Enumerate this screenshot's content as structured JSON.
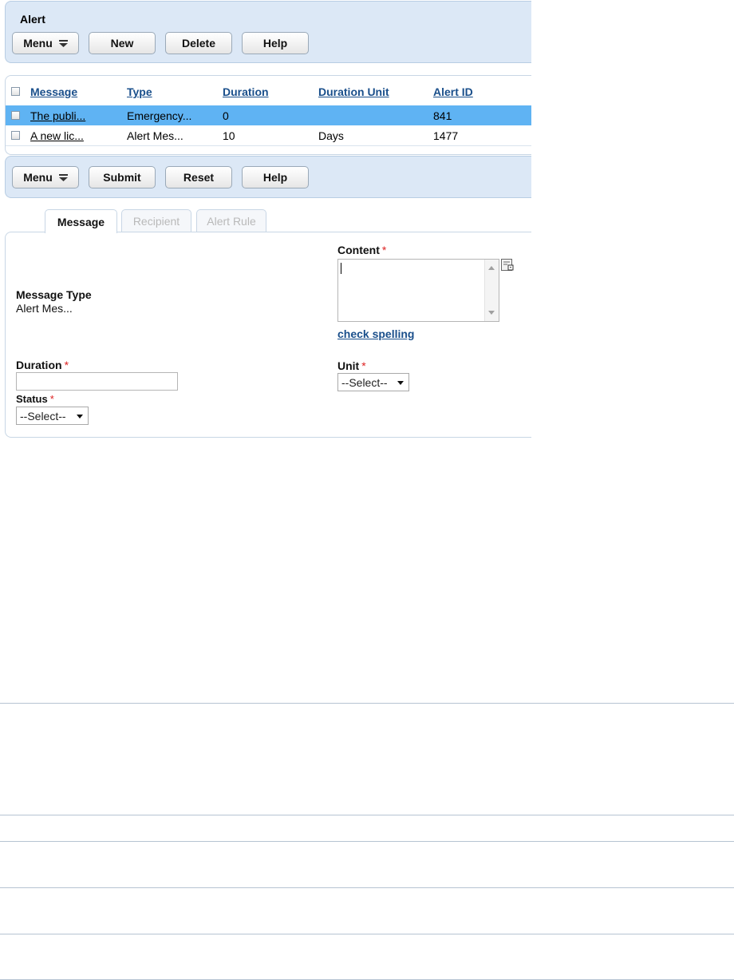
{
  "toolbar_top": {
    "title": "Alert",
    "buttons": [
      "Menu",
      "New",
      "Delete",
      "Help"
    ]
  },
  "grid": {
    "headers": [
      "Message",
      "Type",
      "Duration",
      "Duration Unit",
      "Alert ID"
    ],
    "rows": [
      {
        "message": "The publi...",
        "type": "Emergency...",
        "duration": "0",
        "duration_unit": "",
        "alert_id": "841",
        "selected": true
      },
      {
        "message": "A new lic...",
        "type": "Alert Mes...",
        "duration": "10",
        "duration_unit": "Days",
        "alert_id": "1477",
        "selected": false
      }
    ]
  },
  "toolbar_bottom": {
    "buttons": [
      "Menu",
      "Submit",
      "Reset",
      "Help"
    ]
  },
  "tabs": [
    "Message",
    "Recipient",
    "Alert Rule"
  ],
  "form": {
    "content_label": "Content",
    "content_value": "",
    "check_spelling": "check spelling",
    "message_type_label": "Message Type",
    "message_type_value": "Alert Mes...",
    "duration_label": "Duration",
    "duration_value": "",
    "unit_label": "Unit",
    "unit_value": "--Select--",
    "status_label": "Status",
    "status_value": "--Select--",
    "required_marker": "*"
  },
  "colors": {
    "panel_bg": "#dce8f6",
    "selected_row": "#5fb3f3",
    "link": "#1a4f8b",
    "required": "#dd2222"
  }
}
